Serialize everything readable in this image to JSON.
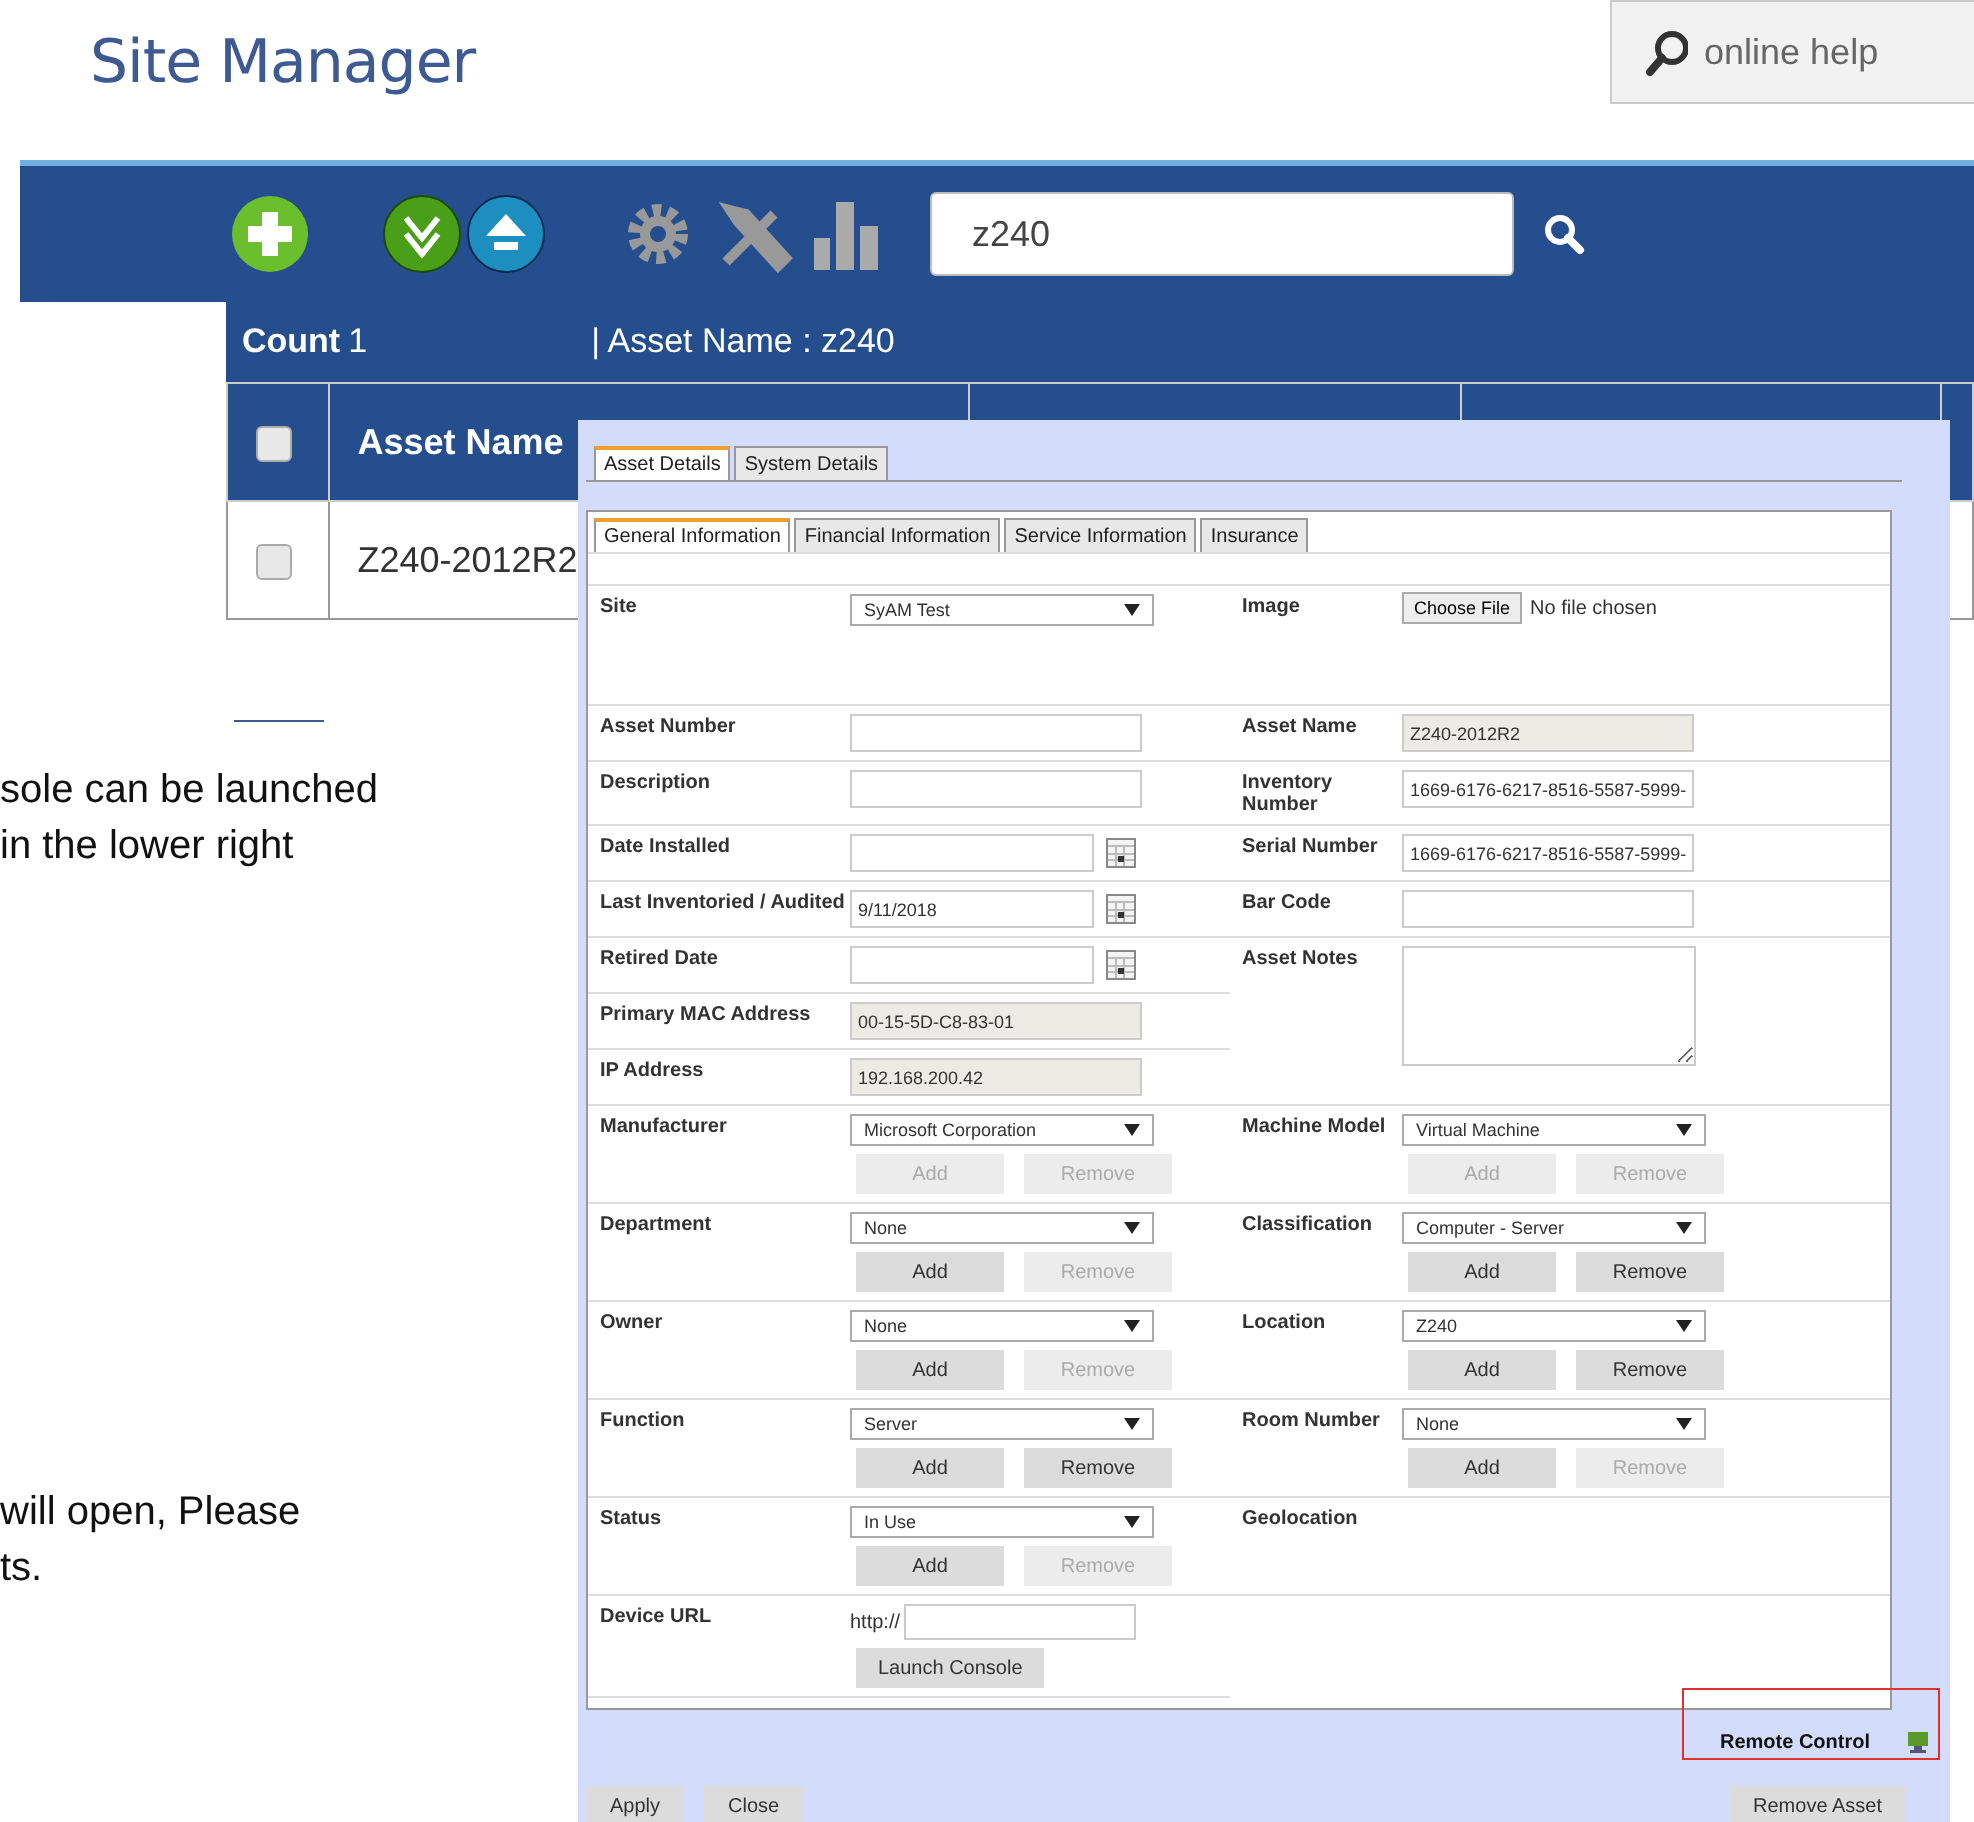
{
  "header": {
    "logo": "Site Manager",
    "help": "online help"
  },
  "toolbar": {
    "search": {
      "value": "z240"
    }
  },
  "summary": {
    "count_label": "Count",
    "count": "1",
    "filter": "| Asset Name : z240"
  },
  "table": {
    "columns": [
      {
        "label": "Asset Name"
      }
    ],
    "rows": [
      {
        "checked": false,
        "cells": [
          "Z240-2012R2"
        ]
      }
    ]
  },
  "header_checkbox": {
    "checked": false
  },
  "document": {
    "lines_top": [
      "sole can be launched",
      "in the lower right"
    ],
    "lines_bottom": [
      "will open, Please",
      "ts."
    ]
  },
  "dialog": {
    "tabs": [
      {
        "label": "Asset Details",
        "selected": true
      },
      {
        "label": "System Details",
        "selected": false
      }
    ],
    "subtabs": [
      {
        "label": "General Information",
        "selected": true
      },
      {
        "label": "Financial Information",
        "selected": false
      },
      {
        "label": "Service Information",
        "selected": false
      },
      {
        "label": "Insurance",
        "selected": false
      }
    ],
    "rows": [
      {
        "left": {
          "label": "Site",
          "kind": "select",
          "value": "SyAM Test"
        },
        "right": {
          "label": "Image",
          "kind": "file",
          "button": "Choose File",
          "value": "No file chosen"
        }
      },
      {
        "left": {
          "label": "Asset Number",
          "kind": "input"
        },
        "right": {
          "label": "Asset Name",
          "kind": "input",
          "value": "Z240-2012R2",
          "readonly": true
        }
      },
      {
        "left": {
          "label": "Description",
          "kind": "input"
        },
        "right": {
          "label": "Inventory Number",
          "kind": "input",
          "value": "1669-6176-6217-8516-5587-5999-"
        }
      },
      {
        "left": {
          "label": "Date Installed",
          "kind": "date"
        },
        "right": {
          "label": "Serial Number",
          "kind": "input",
          "value": "1669-6176-6217-8516-5587-5999-"
        }
      },
      {
        "left": {
          "label": "Last Inventoried / Audited",
          "kind": "date",
          "value": "9/11/2018"
        },
        "right": {
          "label": "Bar Code",
          "kind": "input"
        }
      },
      {
        "left": {
          "label": "Retired Date",
          "kind": "date"
        },
        "right": {
          "label": "Asset Notes",
          "kind": "textarea"
        }
      },
      {
        "left": {
          "label": "Primary MAC Address",
          "kind": "input",
          "value": "00-15-5D-C8-83-01",
          "readonly": true
        }
      },
      {
        "left": {
          "label": "IP Address",
          "kind": "input",
          "value": "192.168.200.42",
          "readonly": true
        }
      },
      {
        "left": {
          "label": "Manufacturer",
          "kind": "select",
          "value": "Microsoft Corporation",
          "buttons": [
            {
              "label": "Add",
              "disabled": true
            },
            {
              "label": "Remove",
              "disabled": true
            }
          ]
        },
        "right": {
          "label": "Machine Model",
          "kind": "select",
          "value": "Virtual Machine",
          "buttons": [
            {
              "label": "Add",
              "disabled": true
            },
            {
              "label": "Remove",
              "disabled": true
            }
          ]
        }
      },
      {
        "left": {
          "label": "Department",
          "kind": "select",
          "value": "None",
          "buttons": [
            {
              "label": "Add",
              "disabled": false
            },
            {
              "label": "Remove",
              "disabled": true
            }
          ]
        },
        "right": {
          "label": "Classification",
          "kind": "select",
          "value": "Computer - Server",
          "buttons": [
            {
              "label": "Add",
              "disabled": false
            },
            {
              "label": "Remove",
              "disabled": false
            }
          ]
        }
      },
      {
        "left": {
          "label": "Owner",
          "kind": "select",
          "value": "None",
          "buttons": [
            {
              "label": "Add",
              "disabled": false
            },
            {
              "label": "Remove",
              "disabled": true
            }
          ]
        },
        "right": {
          "label": "Location",
          "kind": "select",
          "value": "Z240",
          "buttons": [
            {
              "label": "Add",
              "disabled": false
            },
            {
              "label": "Remove",
              "disabled": false
            }
          ]
        }
      },
      {
        "left": {
          "label": "Function",
          "kind": "select",
          "value": "Server",
          "buttons": [
            {
              "label": "Add",
              "disabled": false
            },
            {
              "label": "Remove",
              "disabled": false
            }
          ]
        },
        "right": {
          "label": "Room Number",
          "kind": "select",
          "value": "None",
          "buttons": [
            {
              "label": "Add",
              "disabled": false
            },
            {
              "label": "Remove",
              "disabled": true
            }
          ]
        }
      },
      {
        "left": {
          "label": "Status",
          "kind": "select",
          "value": "In Use",
          "buttons": [
            {
              "label": "Add",
              "disabled": false
            },
            {
              "label": "Remove",
              "disabled": true
            }
          ]
        },
        "right": {
          "label": "Geolocation",
          "kind": "none"
        }
      },
      {
        "left": {
          "label": "Device URL",
          "kind": "url",
          "prefix": "http://",
          "buttons": [
            {
              "label": "Launch Console",
              "disabled": false
            }
          ]
        }
      }
    ],
    "remote": {
      "label": "Remote Control"
    },
    "footer_left": [
      "Apply",
      "Close"
    ],
    "footer_right": [
      "Remove Asset"
    ]
  }
}
